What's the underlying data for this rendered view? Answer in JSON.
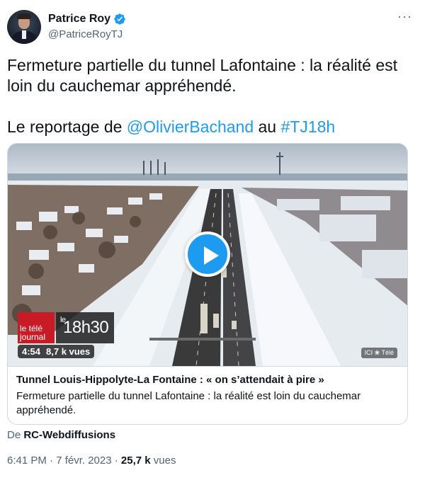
{
  "author": {
    "name": "Patrice Roy",
    "handle": "@PatriceRoyTJ",
    "verified_color": "#1d9bf0"
  },
  "more_menu": "···",
  "tweet": {
    "line1": "Fermeture partielle du tunnel Lafontaine : la réalité est loin du cauchemar appréhendé.",
    "line2_prefix": "Le reportage de ",
    "mention": "@OlivierBachand",
    "line2_middle": " au ",
    "hashtag": "#TJ18h"
  },
  "card": {
    "logo_tele": "le télé journal",
    "logo_18h30_prefix": "le",
    "logo_18h30": "18h30",
    "duration": "4:54",
    "views": "8,7 k vues",
    "ici_badge": "ICI ❀ Télé",
    "title": "Tunnel Louis-Hippolyte-La Fontaine : « on s’attendait à pire »",
    "description": "Fermeture partielle du tunnel Lafontaine : la réalité est loin du cauchemar appréhendé."
  },
  "source": {
    "prefix": "De ",
    "name": "RC-Webdiffusions"
  },
  "meta": {
    "timestamp": "6:41 PM · 7 févr. 2023 · ",
    "view_count": "25,7 k",
    "view_label": " vues"
  },
  "colors": {
    "accent": "#1d9bf0",
    "text": "#0f1419",
    "secondary": "#536471",
    "border": "#cfd9de"
  }
}
